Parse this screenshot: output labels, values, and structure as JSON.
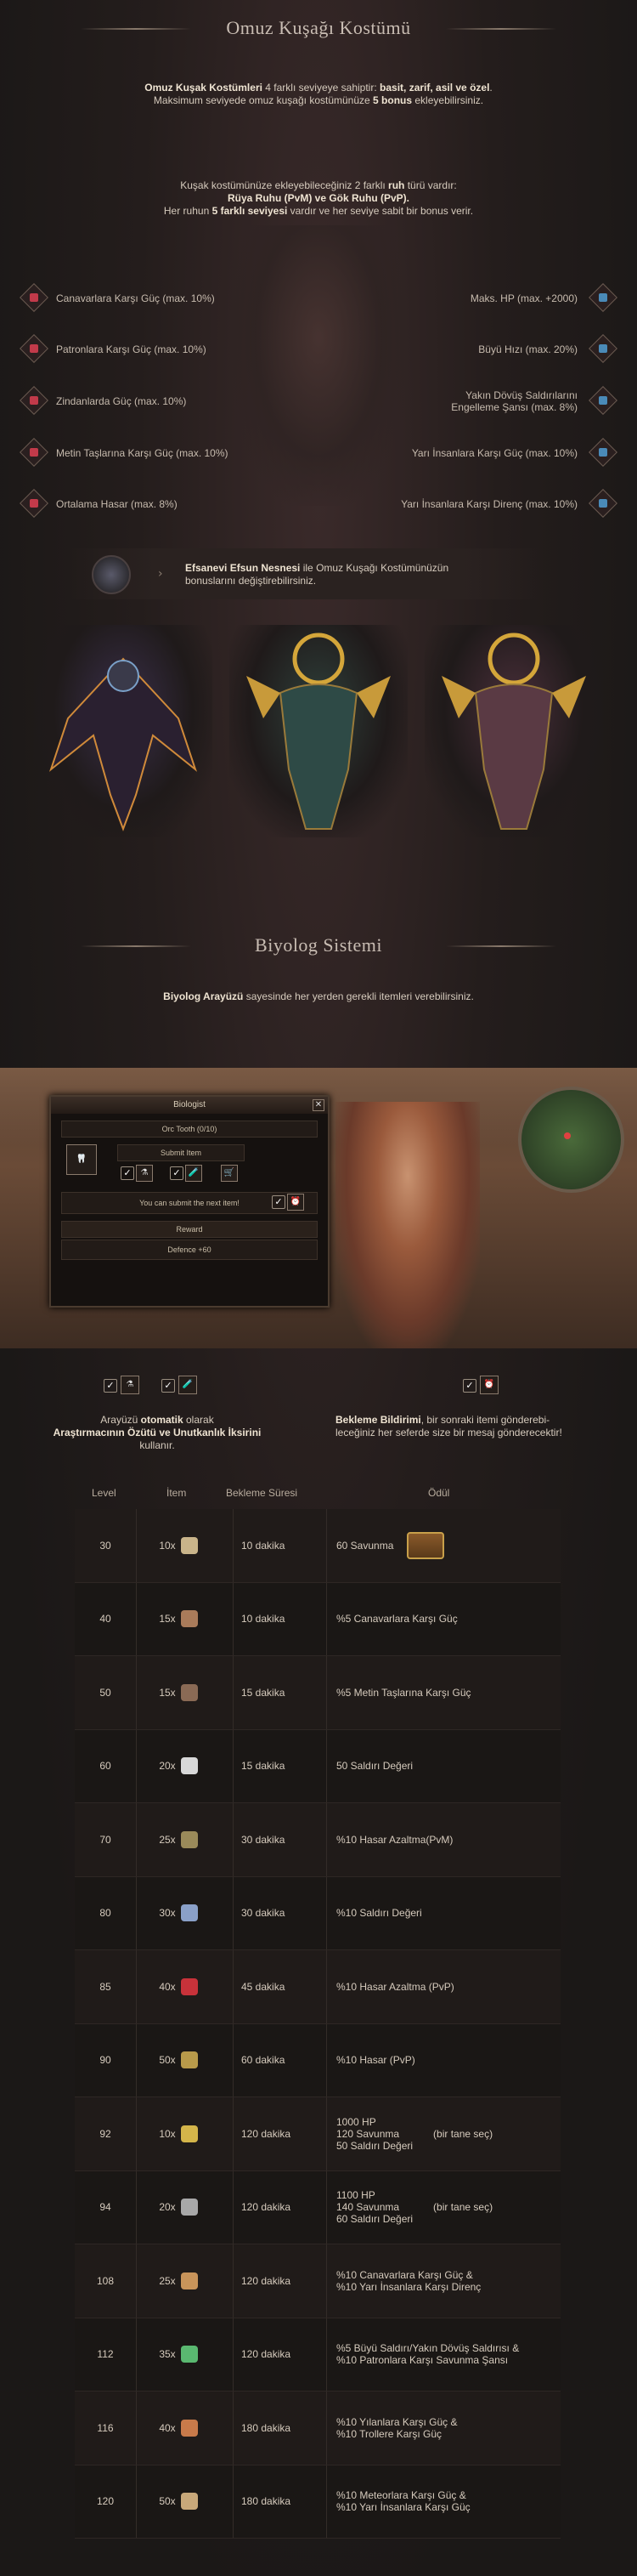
{
  "section1": {
    "title": "Omuz Kuşağı Kostümü",
    "intro_l1a": "Omuz Kuşak Kostümleri",
    "intro_l1b": " 4 farklı seviyeye sahiptir: ",
    "intro_l1c": "basit, zarif, asil ve özel",
    "intro_l2a": "Maksimum seviyede omuz kuşağı kostümünüze ",
    "intro_l2b": "5 bonus",
    "intro_l2c": " ekleyebilirsiniz.",
    "ruh_l1a": "Kuşak kostümünüze ekleyebileceğiniz 2 farklı ",
    "ruh_l1b": "ruh",
    "ruh_l1c": " türü vardır:",
    "ruh_l2": "Rüya Ruhu (PvM) ve Gök Ruhu (PvP).",
    "ruh_l3a": "Her ruhun ",
    "ruh_l3b": "5 farklı seviyesi",
    "ruh_l3c": " vardır ve her seviye sabit bir bonus verir.",
    "left_bonuses": [
      "Canavarlara Karşı Güç (max. 10%)",
      "Patronlara Karşı Güç (max. 10%)",
      "Zindanlarda Güç (max. 10%)",
      "Metin Taşlarına Karşı Güç (max. 10%)",
      "Ortalama Hasar (max. 8%)"
    ],
    "right_bonuses": [
      "Maks. HP (max. +2000)",
      "Büyü Hızı (max. 20%)",
      "Yakın Dövüş Saldırılarını Engelleme Şansı (max. 8%)",
      "Yarı İnsanlara Karşı Güç (max. 10%)",
      "Yarı İnsanlara Karşı Direnç (max. 10%)"
    ],
    "efsun_a": "Efsanevi Efsun Nesnesi",
    "efsun_b": " ile Omuz Kuşağı Kostümünüzün",
    "efsun_c": "bonuslarını değiştirebilirsiniz."
  },
  "section2": {
    "title": "Biyolog Sistemi",
    "intro_a": "Biyolog Arayüzü",
    "intro_b": " sayesinde her yerden gerekli itemleri verebilirsiniz."
  },
  "biolog_window": {
    "title": "Biologist",
    "item": "Orc Tooth (0/10)",
    "submit": "Submit Item",
    "message": "You can submit the next item!",
    "reward_label": "Reward",
    "reward": "Defence +60"
  },
  "features": {
    "auto_a": "Arayüzü ",
    "auto_b": "otomatik",
    "auto_c": " olarak",
    "auto_d": "Araştırmacının Özütü ve Unutkanlık İksirini",
    "auto_e": "kullanır.",
    "notify_a": "Bekleme Bildirimi",
    "notify_b": ", bir sonraki itemi gönderebi-",
    "notify_c": "leceğiniz her seferde size bir mesaj gönderecektir!"
  },
  "table": {
    "headers": [
      "Level",
      "İtem",
      "Bekleme Süresi",
      "Ödül"
    ],
    "rows": [
      {
        "level": "30",
        "qty": "10x",
        "wait": "10 dakika",
        "reward": [
          "60 Savunma"
        ],
        "icon_color": "#c9b48a"
      },
      {
        "level": "40",
        "qty": "15x",
        "wait": "10 dakika",
        "reward": [
          "%5 Canavarlara Karşı Güç"
        ],
        "icon_color": "#a97b5a"
      },
      {
        "level": "50",
        "qty": "15x",
        "wait": "15 dakika",
        "reward": [
          "%5 Metin Taşlarına Karşı Güç"
        ],
        "icon_color": "#8a6a55"
      },
      {
        "level": "60",
        "qty": "20x",
        "wait": "15 dakika",
        "reward": [
          "50 Saldırı Değeri"
        ],
        "icon_color": "#d8d8d8"
      },
      {
        "level": "70",
        "qty": "25x",
        "wait": "30 dakika",
        "reward": [
          "%10 Hasar Azaltma(PvM)"
        ],
        "icon_color": "#9a8a5a"
      },
      {
        "level": "80",
        "qty": "30x",
        "wait": "30 dakika",
        "reward": [
          "%10 Saldırı Değeri"
        ],
        "icon_color": "#8aa0c8"
      },
      {
        "level": "85",
        "qty": "40x",
        "wait": "45 dakika",
        "reward": [
          "%10 Hasar Azaltma (PvP)"
        ],
        "icon_color": "#c8323a"
      },
      {
        "level": "90",
        "qty": "50x",
        "wait": "60 dakika",
        "reward": [
          "%10 Hasar (PvP)"
        ],
        "icon_color": "#b89a4a"
      },
      {
        "level": "92",
        "qty": "10x",
        "wait": "120 dakika",
        "reward": [
          "1000 HP",
          "120 Savunma",
          "50 Saldırı Değeri"
        ],
        "note": "(bir tane seç)",
        "icon_color": "#d4b54a"
      },
      {
        "level": "94",
        "qty": "20x",
        "wait": "120 dakika",
        "reward": [
          "1100 HP",
          "140 Savunma",
          "60 Saldırı Değeri"
        ],
        "note": "(bir tane seç)",
        "icon_color": "#a8a8a8"
      },
      {
        "level": "108",
        "qty": "25x",
        "wait": "120 dakika",
        "reward": [
          "%10 Canavarlara Karşı Güç  &",
          "%10 Yarı İnsanlara Karşı Direnç"
        ],
        "icon_color": "#c8945a"
      },
      {
        "level": "112",
        "qty": "35x",
        "wait": "120 dakika",
        "reward": [
          "%5 Büyü Saldırı/Yakın Dövüş Saldırısı  &",
          "%10 Patronlara Karşı Savunma Şansı"
        ],
        "icon_color": "#5ab870"
      },
      {
        "level": "116",
        "qty": "40x",
        "wait": "180 dakika",
        "reward": [
          "%10 Yılanlara Karşı Güç   &",
          "%10 Trollere Karşı Güç"
        ],
        "icon_color": "#c87a4a"
      },
      {
        "level": "120",
        "qty": "50x",
        "wait": "180 dakika",
        "reward": [
          "%10 Meteorlara Karşı Güç   &",
          "%10 Yarı İnsanlara Karşı Güç"
        ],
        "icon_color": "#c8a87a"
      }
    ]
  }
}
